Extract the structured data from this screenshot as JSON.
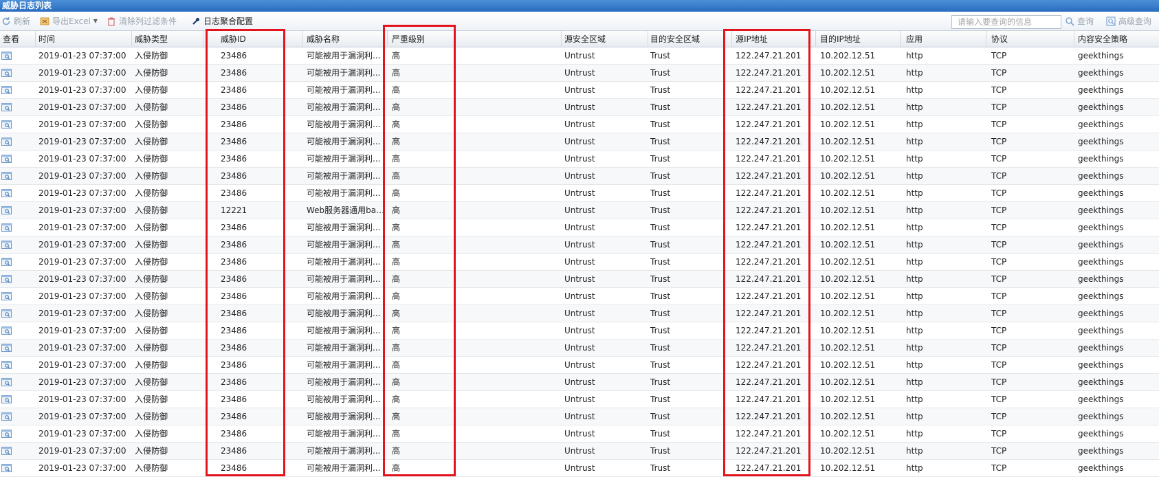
{
  "window": {
    "title": "威胁日志列表"
  },
  "toolbar": {
    "refresh_label": "刷新",
    "export_label": "导出Excel",
    "clear_filter_label": "清除列过滤条件",
    "log_aggregate_label": "日志聚合配置",
    "search_placeholder": "请输入要查询的信息",
    "search_label": "查询",
    "advanced_label": "高级查询"
  },
  "columns": [
    "查看",
    "时间",
    "威胁类型",
    "威胁ID",
    "威胁名称",
    "严重级别",
    "源安全区域",
    "目的安全区域",
    "源IP地址",
    "目的IP地址",
    "应用",
    "协议",
    "内容安全策略"
  ],
  "rows": [
    {
      "time": "2019-01-23 07:37:00",
      "type": "入侵防御",
      "id": "23486",
      "name": "可能被用于漏洞利...",
      "severity": "高",
      "src_zone": "Untrust",
      "dst_zone": "Trust",
      "src_ip": "122.247.21.201",
      "dst_ip": "10.202.12.51",
      "app": "http",
      "proto": "TCP",
      "policy": "geekthings"
    },
    {
      "time": "2019-01-23 07:37:00",
      "type": "入侵防御",
      "id": "23486",
      "name": "可能被用于漏洞利...",
      "severity": "高",
      "src_zone": "Untrust",
      "dst_zone": "Trust",
      "src_ip": "122.247.21.201",
      "dst_ip": "10.202.12.51",
      "app": "http",
      "proto": "TCP",
      "policy": "geekthings"
    },
    {
      "time": "2019-01-23 07:37:00",
      "type": "入侵防御",
      "id": "23486",
      "name": "可能被用于漏洞利...",
      "severity": "高",
      "src_zone": "Untrust",
      "dst_zone": "Trust",
      "src_ip": "122.247.21.201",
      "dst_ip": "10.202.12.51",
      "app": "http",
      "proto": "TCP",
      "policy": "geekthings"
    },
    {
      "time": "2019-01-23 07:37:00",
      "type": "入侵防御",
      "id": "23486",
      "name": "可能被用于漏洞利...",
      "severity": "高",
      "src_zone": "Untrust",
      "dst_zone": "Trust",
      "src_ip": "122.247.21.201",
      "dst_ip": "10.202.12.51",
      "app": "http",
      "proto": "TCP",
      "policy": "geekthings"
    },
    {
      "time": "2019-01-23 07:37:00",
      "type": "入侵防御",
      "id": "23486",
      "name": "可能被用于漏洞利...",
      "severity": "高",
      "src_zone": "Untrust",
      "dst_zone": "Trust",
      "src_ip": "122.247.21.201",
      "dst_ip": "10.202.12.51",
      "app": "http",
      "proto": "TCP",
      "policy": "geekthings"
    },
    {
      "time": "2019-01-23 07:37:00",
      "type": "入侵防御",
      "id": "23486",
      "name": "可能被用于漏洞利...",
      "severity": "高",
      "src_zone": "Untrust",
      "dst_zone": "Trust",
      "src_ip": "122.247.21.201",
      "dst_ip": "10.202.12.51",
      "app": "http",
      "proto": "TCP",
      "policy": "geekthings"
    },
    {
      "time": "2019-01-23 07:37:00",
      "type": "入侵防御",
      "id": "23486",
      "name": "可能被用于漏洞利...",
      "severity": "高",
      "src_zone": "Untrust",
      "dst_zone": "Trust",
      "src_ip": "122.247.21.201",
      "dst_ip": "10.202.12.51",
      "app": "http",
      "proto": "TCP",
      "policy": "geekthings"
    },
    {
      "time": "2019-01-23 07:37:00",
      "type": "入侵防御",
      "id": "23486",
      "name": "可能被用于漏洞利...",
      "severity": "高",
      "src_zone": "Untrust",
      "dst_zone": "Trust",
      "src_ip": "122.247.21.201",
      "dst_ip": "10.202.12.51",
      "app": "http",
      "proto": "TCP",
      "policy": "geekthings"
    },
    {
      "time": "2019-01-23 07:37:00",
      "type": "入侵防御",
      "id": "23486",
      "name": "可能被用于漏洞利...",
      "severity": "高",
      "src_zone": "Untrust",
      "dst_zone": "Trust",
      "src_ip": "122.247.21.201",
      "dst_ip": "10.202.12.51",
      "app": "http",
      "proto": "TCP",
      "policy": "geekthings"
    },
    {
      "time": "2019-01-23 07:37:00",
      "type": "入侵防御",
      "id": "12221",
      "name": "Web服务器通用bas...",
      "severity": "高",
      "src_zone": "Untrust",
      "dst_zone": "Trust",
      "src_ip": "122.247.21.201",
      "dst_ip": "10.202.12.51",
      "app": "http",
      "proto": "TCP",
      "policy": "geekthings"
    },
    {
      "time": "2019-01-23 07:37:00",
      "type": "入侵防御",
      "id": "23486",
      "name": "可能被用于漏洞利...",
      "severity": "高",
      "src_zone": "Untrust",
      "dst_zone": "Trust",
      "src_ip": "122.247.21.201",
      "dst_ip": "10.202.12.51",
      "app": "http",
      "proto": "TCP",
      "policy": "geekthings"
    },
    {
      "time": "2019-01-23 07:37:00",
      "type": "入侵防御",
      "id": "23486",
      "name": "可能被用于漏洞利...",
      "severity": "高",
      "src_zone": "Untrust",
      "dst_zone": "Trust",
      "src_ip": "122.247.21.201",
      "dst_ip": "10.202.12.51",
      "app": "http",
      "proto": "TCP",
      "policy": "geekthings"
    },
    {
      "time": "2019-01-23 07:37:00",
      "type": "入侵防御",
      "id": "23486",
      "name": "可能被用于漏洞利...",
      "severity": "高",
      "src_zone": "Untrust",
      "dst_zone": "Trust",
      "src_ip": "122.247.21.201",
      "dst_ip": "10.202.12.51",
      "app": "http",
      "proto": "TCP",
      "policy": "geekthings"
    },
    {
      "time": "2019-01-23 07:37:00",
      "type": "入侵防御",
      "id": "23486",
      "name": "可能被用于漏洞利...",
      "severity": "高",
      "src_zone": "Untrust",
      "dst_zone": "Trust",
      "src_ip": "122.247.21.201",
      "dst_ip": "10.202.12.51",
      "app": "http",
      "proto": "TCP",
      "policy": "geekthings"
    },
    {
      "time": "2019-01-23 07:37:00",
      "type": "入侵防御",
      "id": "23486",
      "name": "可能被用于漏洞利...",
      "severity": "高",
      "src_zone": "Untrust",
      "dst_zone": "Trust",
      "src_ip": "122.247.21.201",
      "dst_ip": "10.202.12.51",
      "app": "http",
      "proto": "TCP",
      "policy": "geekthings"
    },
    {
      "time": "2019-01-23 07:37:00",
      "type": "入侵防御",
      "id": "23486",
      "name": "可能被用于漏洞利...",
      "severity": "高",
      "src_zone": "Untrust",
      "dst_zone": "Trust",
      "src_ip": "122.247.21.201",
      "dst_ip": "10.202.12.51",
      "app": "http",
      "proto": "TCP",
      "policy": "geekthings"
    },
    {
      "time": "2019-01-23 07:37:00",
      "type": "入侵防御",
      "id": "23486",
      "name": "可能被用于漏洞利...",
      "severity": "高",
      "src_zone": "Untrust",
      "dst_zone": "Trust",
      "src_ip": "122.247.21.201",
      "dst_ip": "10.202.12.51",
      "app": "http",
      "proto": "TCP",
      "policy": "geekthings"
    },
    {
      "time": "2019-01-23 07:37:00",
      "type": "入侵防御",
      "id": "23486",
      "name": "可能被用于漏洞利...",
      "severity": "高",
      "src_zone": "Untrust",
      "dst_zone": "Trust",
      "src_ip": "122.247.21.201",
      "dst_ip": "10.202.12.51",
      "app": "http",
      "proto": "TCP",
      "policy": "geekthings"
    },
    {
      "time": "2019-01-23 07:37:00",
      "type": "入侵防御",
      "id": "23486",
      "name": "可能被用于漏洞利...",
      "severity": "高",
      "src_zone": "Untrust",
      "dst_zone": "Trust",
      "src_ip": "122.247.21.201",
      "dst_ip": "10.202.12.51",
      "app": "http",
      "proto": "TCP",
      "policy": "geekthings"
    },
    {
      "time": "2019-01-23 07:37:00",
      "type": "入侵防御",
      "id": "23486",
      "name": "可能被用于漏洞利...",
      "severity": "高",
      "src_zone": "Untrust",
      "dst_zone": "Trust",
      "src_ip": "122.247.21.201",
      "dst_ip": "10.202.12.51",
      "app": "http",
      "proto": "TCP",
      "policy": "geekthings"
    },
    {
      "time": "2019-01-23 07:37:00",
      "type": "入侵防御",
      "id": "23486",
      "name": "可能被用于漏洞利...",
      "severity": "高",
      "src_zone": "Untrust",
      "dst_zone": "Trust",
      "src_ip": "122.247.21.201",
      "dst_ip": "10.202.12.51",
      "app": "http",
      "proto": "TCP",
      "policy": "geekthings"
    },
    {
      "time": "2019-01-23 07:37:00",
      "type": "入侵防御",
      "id": "23486",
      "name": "可能被用于漏洞利...",
      "severity": "高",
      "src_zone": "Untrust",
      "dst_zone": "Trust",
      "src_ip": "122.247.21.201",
      "dst_ip": "10.202.12.51",
      "app": "http",
      "proto": "TCP",
      "policy": "geekthings"
    },
    {
      "time": "2019-01-23 07:37:00",
      "type": "入侵防御",
      "id": "23486",
      "name": "可能被用于漏洞利...",
      "severity": "高",
      "src_zone": "Untrust",
      "dst_zone": "Trust",
      "src_ip": "122.247.21.201",
      "dst_ip": "10.202.12.51",
      "app": "http",
      "proto": "TCP",
      "policy": "geekthings"
    },
    {
      "time": "2019-01-23 07:37:00",
      "type": "入侵防御",
      "id": "23486",
      "name": "可能被用于漏洞利...",
      "severity": "高",
      "src_zone": "Untrust",
      "dst_zone": "Trust",
      "src_ip": "122.247.21.201",
      "dst_ip": "10.202.12.51",
      "app": "http",
      "proto": "TCP",
      "policy": "geekthings"
    },
    {
      "time": "2019-01-23 07:37:00",
      "type": "入侵防御",
      "id": "23486",
      "name": "可能被用于漏洞利...",
      "severity": "高",
      "src_zone": "Untrust",
      "dst_zone": "Trust",
      "src_ip": "122.247.21.201",
      "dst_ip": "10.202.12.51",
      "app": "http",
      "proto": "TCP",
      "policy": "geekthings"
    }
  ],
  "icons": {
    "refresh": "refresh-icon",
    "export": "excel-icon",
    "clear": "trash-icon",
    "aggregate": "wrench-icon",
    "search": "magnifier-icon",
    "advanced": "advanced-search-icon",
    "view": "view-detail-icon"
  },
  "colors": {
    "titlebar": "#2a6cc0",
    "highlight_box": "#e3141c"
  }
}
